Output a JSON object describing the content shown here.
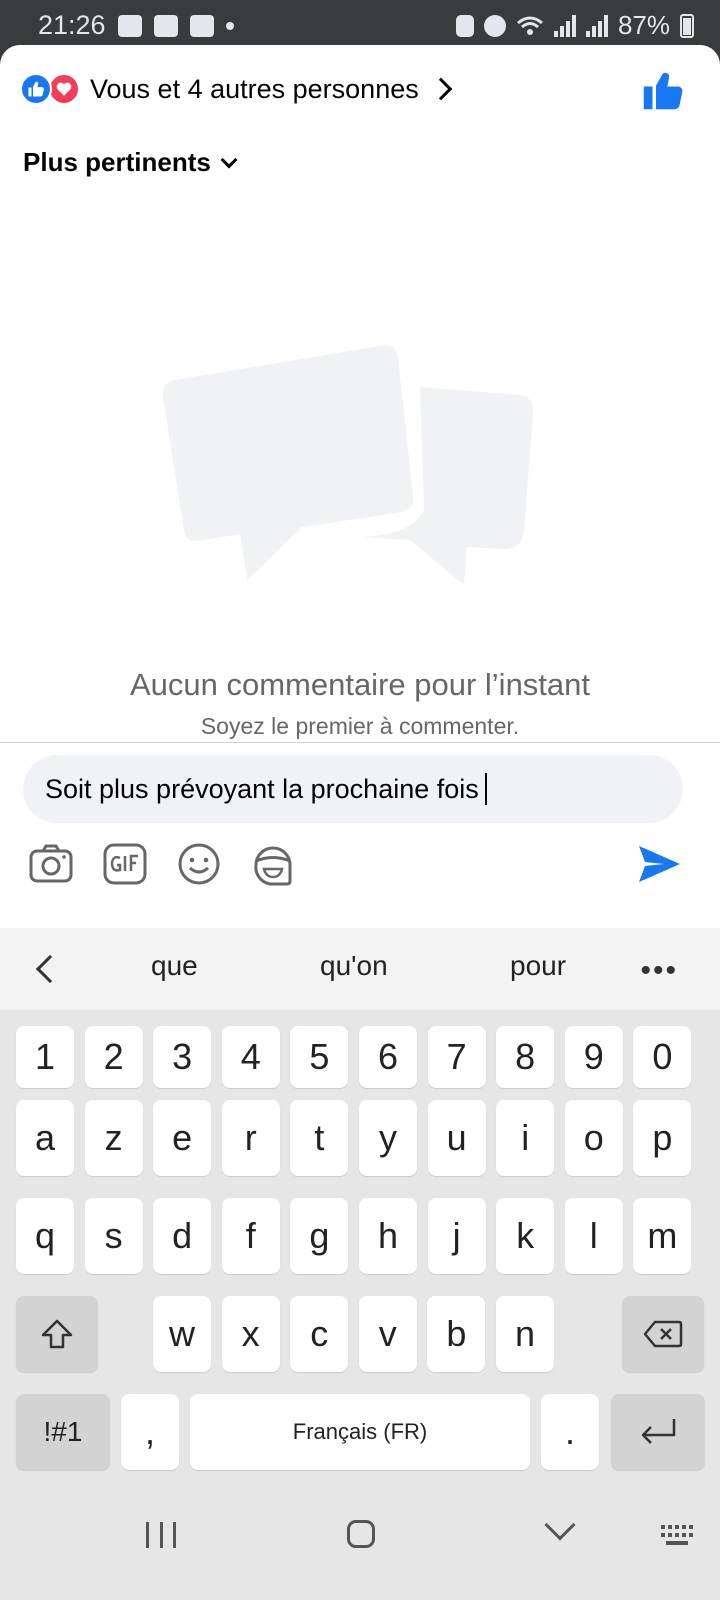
{
  "status_bar": {
    "time": "21:26",
    "battery": "87%"
  },
  "reactions": {
    "summary": "Vous et 4 autres personnes"
  },
  "sort": {
    "label": "Plus pertinents"
  },
  "empty_state": {
    "title": "Aucun commentaire pour l’instant",
    "subtitle": "Soyez le premier à commenter."
  },
  "composer": {
    "text": "Soit plus prévoyant la prochaine fois"
  },
  "keyboard": {
    "suggestions": [
      "que",
      "qu'on",
      "pour"
    ],
    "row_numbers": [
      "1",
      "2",
      "3",
      "4",
      "5",
      "6",
      "7",
      "8",
      "9",
      "0"
    ],
    "row_1": [
      "a",
      "z",
      "e",
      "r",
      "t",
      "y",
      "u",
      "i",
      "o",
      "p"
    ],
    "row_2": [
      "q",
      "s",
      "d",
      "f",
      "g",
      "h",
      "j",
      "k",
      "l",
      "m"
    ],
    "row_3": [
      "w",
      "x",
      "c",
      "v",
      "b",
      "n"
    ],
    "symbols_label": "!#1",
    "comma": ",",
    "space_label": "Français (FR)",
    "period": "."
  },
  "colors": {
    "accent": "#1877f2",
    "love": "#f33e58",
    "muted_text": "#65676b",
    "input_bg": "#f0f2f5"
  }
}
